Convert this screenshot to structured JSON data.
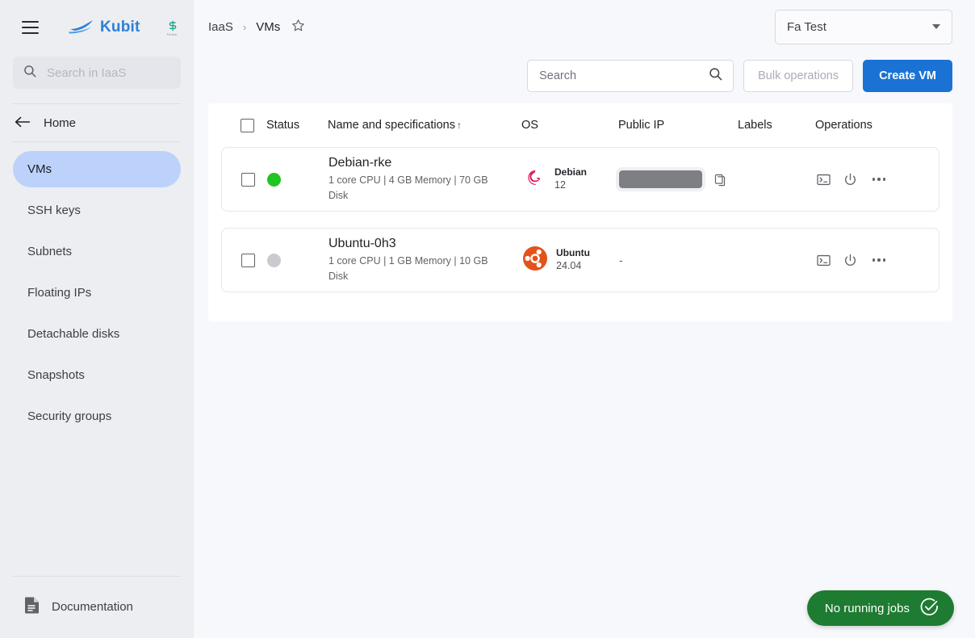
{
  "sidebar": {
    "menu_icon": "hamburger-icon",
    "brand": "Kubit",
    "brand_logo_icon": "kubit-boat-logo",
    "partner_logo_icon": "partner-s-logo",
    "partner_logo_letter": "S",
    "partner_logo_sub": "Partner",
    "search": {
      "placeholder": "Search in IaaS",
      "value": "",
      "icon": "search-icon"
    },
    "home": {
      "label": "Home",
      "icon": "arrow-left-icon"
    },
    "items": [
      {
        "label": "VMs",
        "active": true
      },
      {
        "label": "SSH keys",
        "active": false
      },
      {
        "label": "Subnets",
        "active": false
      },
      {
        "label": "Floating IPs",
        "active": false
      },
      {
        "label": "Detachable disks",
        "active": false
      },
      {
        "label": "Snapshots",
        "active": false
      },
      {
        "label": "Security groups",
        "active": false
      }
    ],
    "documentation": {
      "label": "Documentation",
      "icon": "document-icon"
    }
  },
  "topbar": {
    "breadcrumb": {
      "root": "IaaS",
      "separator": "›",
      "current": "VMs",
      "favorite_icon": "star-outline-icon"
    },
    "project_selector": {
      "value": "Fa Test",
      "caret_icon": "chevron-down-icon"
    }
  },
  "actionbar": {
    "search": {
      "placeholder": "Search",
      "value": "",
      "icon": "search-icon"
    },
    "bulk_operations_label": "Bulk operations",
    "create_vm_label": "Create VM"
  },
  "table": {
    "headers": {
      "select_all": "",
      "status": "Status",
      "name": "Name and specifications",
      "sort_indicator": "↑",
      "os": "OS",
      "public_ip": "Public IP",
      "labels": "Labels",
      "operations": "Operations"
    },
    "rows": [
      {
        "status": "running",
        "name": "Debian-rke",
        "spec": "1 core CPU | 4 GB Memory | 70 GB Disk",
        "os_name": "Debian",
        "os_version": "12",
        "os_icon": "debian-logo",
        "public_ip": "",
        "public_ip_redacted": true,
        "copy_icon": "copy-icon",
        "labels": "",
        "ops": {
          "console_icon": "terminal-console-icon",
          "power_icon": "power-icon",
          "more_icon": "more-horizontal-icon"
        }
      },
      {
        "status": "stopped",
        "name": "Ubuntu-0h3",
        "spec": "1 core CPU | 1 GB Memory | 10 GB Disk",
        "os_name": "Ubuntu",
        "os_version": "24.04",
        "os_icon": "ubuntu-logo",
        "public_ip": "-",
        "public_ip_redacted": false,
        "copy_icon": "",
        "labels": "",
        "ops": {
          "console_icon": "terminal-console-icon",
          "power_icon": "power-icon",
          "more_icon": "more-horizontal-icon"
        }
      }
    ]
  },
  "toast": {
    "label": "No running jobs",
    "icon": "check-circle-icon"
  },
  "annotation": {
    "arrow_icon": "red-arrow-pointing-to-more-menu",
    "color": "#e02020"
  },
  "colors": {
    "accent": "#1a73d4",
    "brand": "#2f7fd6",
    "sidebar_bg": "#eceef2",
    "active_nav": "#bcd2fb",
    "status_running": "#21c521",
    "status_stopped": "#c9cbcf",
    "toast_bg": "#1e7b32",
    "debian": "#d70a53",
    "ubuntu": "#e4511b"
  }
}
